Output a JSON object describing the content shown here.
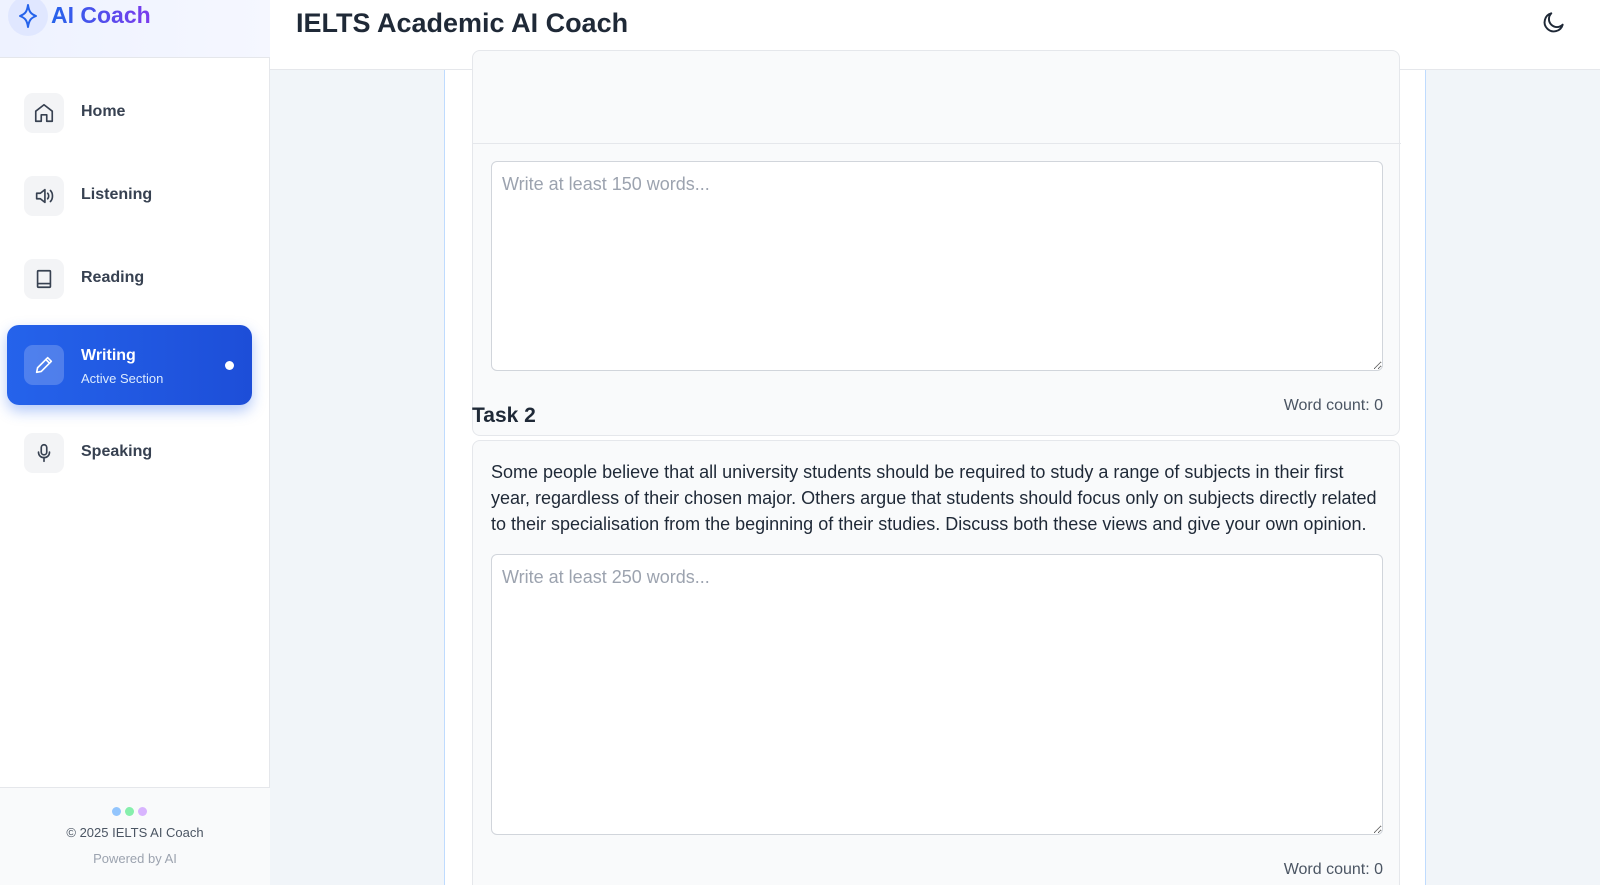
{
  "brand": {
    "title": "AI Coach",
    "icon": "sparkle-icon"
  },
  "header": {
    "title": "IELTS Academic AI Coach",
    "theme_icon": "moon-icon"
  },
  "sidebar": {
    "items": [
      {
        "label": "Home",
        "icon": "home-icon"
      },
      {
        "label": "Listening",
        "icon": "speaker-icon"
      },
      {
        "label": "Reading",
        "icon": "book-icon"
      },
      {
        "label": "Writing",
        "sublabel": "Active Section",
        "icon": "pencil-icon",
        "active": true
      },
      {
        "label": "Speaking",
        "icon": "microphone-icon"
      }
    ],
    "footer": {
      "copyright": "© 2025 IELTS AI Coach",
      "powered": "Powered by AI",
      "dot_colors": [
        "#93c5fd",
        "#86efac",
        "#d8b4fe"
      ]
    }
  },
  "task1": {
    "placeholder": "Write at least 150 words...",
    "value": "",
    "word_count": "Word count: 0"
  },
  "task2": {
    "title": "Task 2",
    "prompt": "Some people believe that all university students should be required to study a range of subjects in their first year, regardless of their chosen major. Others argue that students should focus only on subjects directly related to their specialisation from the beginning of their studies. Discuss both these views and give your own opinion.",
    "placeholder": "Write at least 250 words...",
    "value": "",
    "word_count": "Word count: 0"
  },
  "colors": {
    "accent": "#2563eb",
    "accent_dark": "#1d4ed8",
    "brand_gradient_end": "#7c3aed"
  }
}
